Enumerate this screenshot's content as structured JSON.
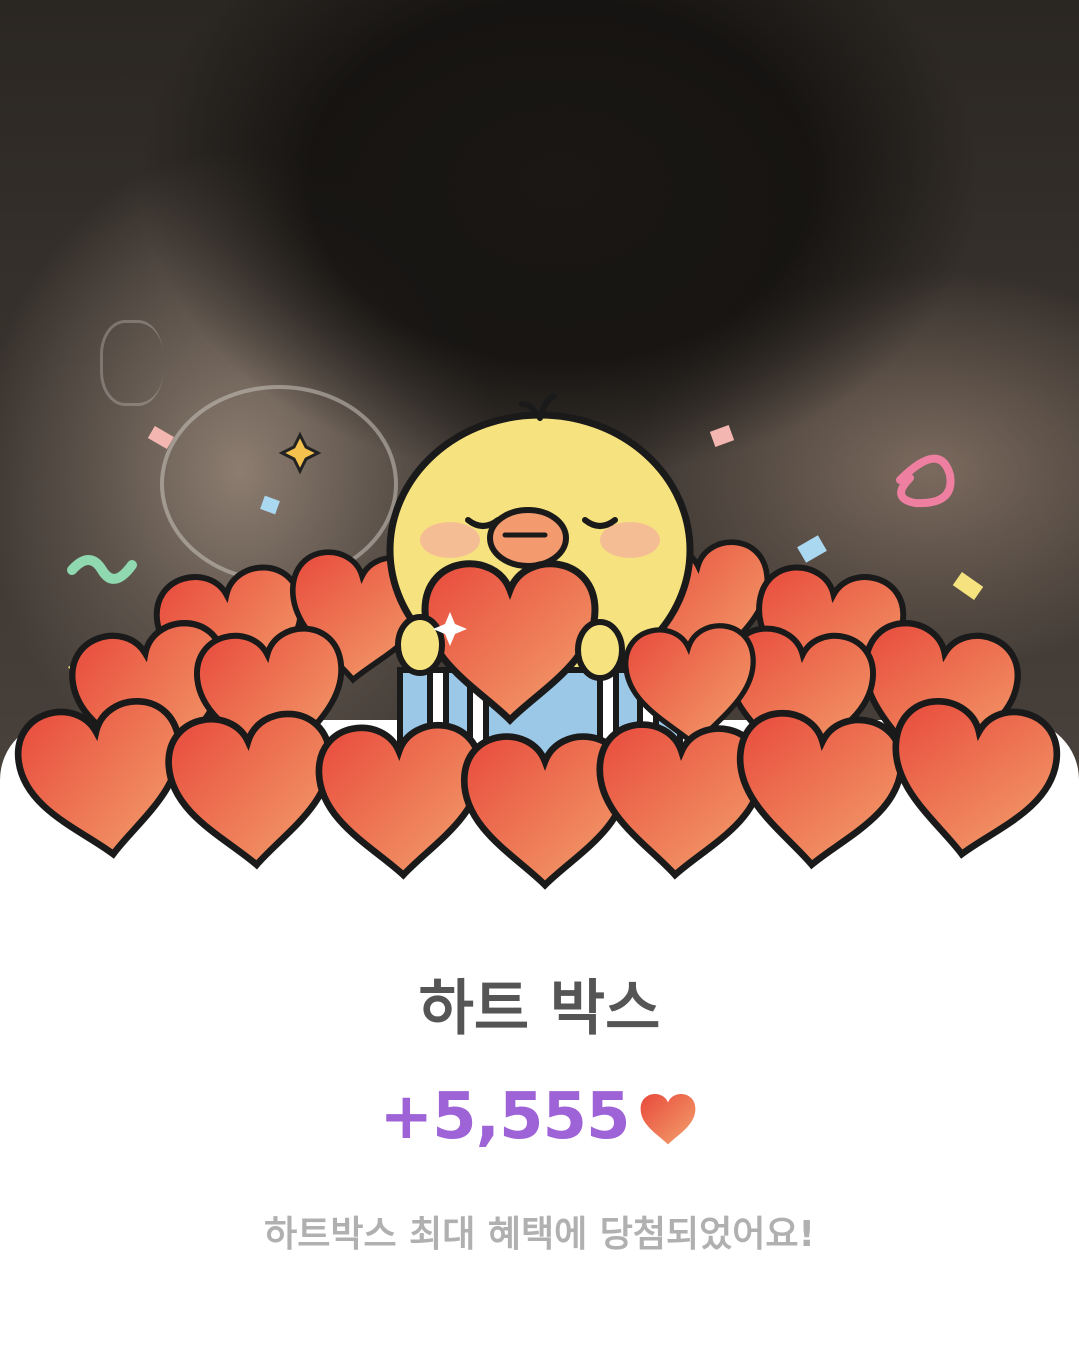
{
  "background": {
    "description_icon": "profile-photo-icon"
  },
  "reward": {
    "title": "하트 박스",
    "amount": "+5,555",
    "currency_icon": "heart-icon",
    "message": "하트박스 최대 혜택에 당첨되었어요!"
  },
  "colors": {
    "amount": "#9e63d6",
    "title": "#555555",
    "message": "#b0b0b0",
    "heart_top": "#e84a3c",
    "heart_bottom": "#f3a26d",
    "chick": "#f6e27e"
  }
}
